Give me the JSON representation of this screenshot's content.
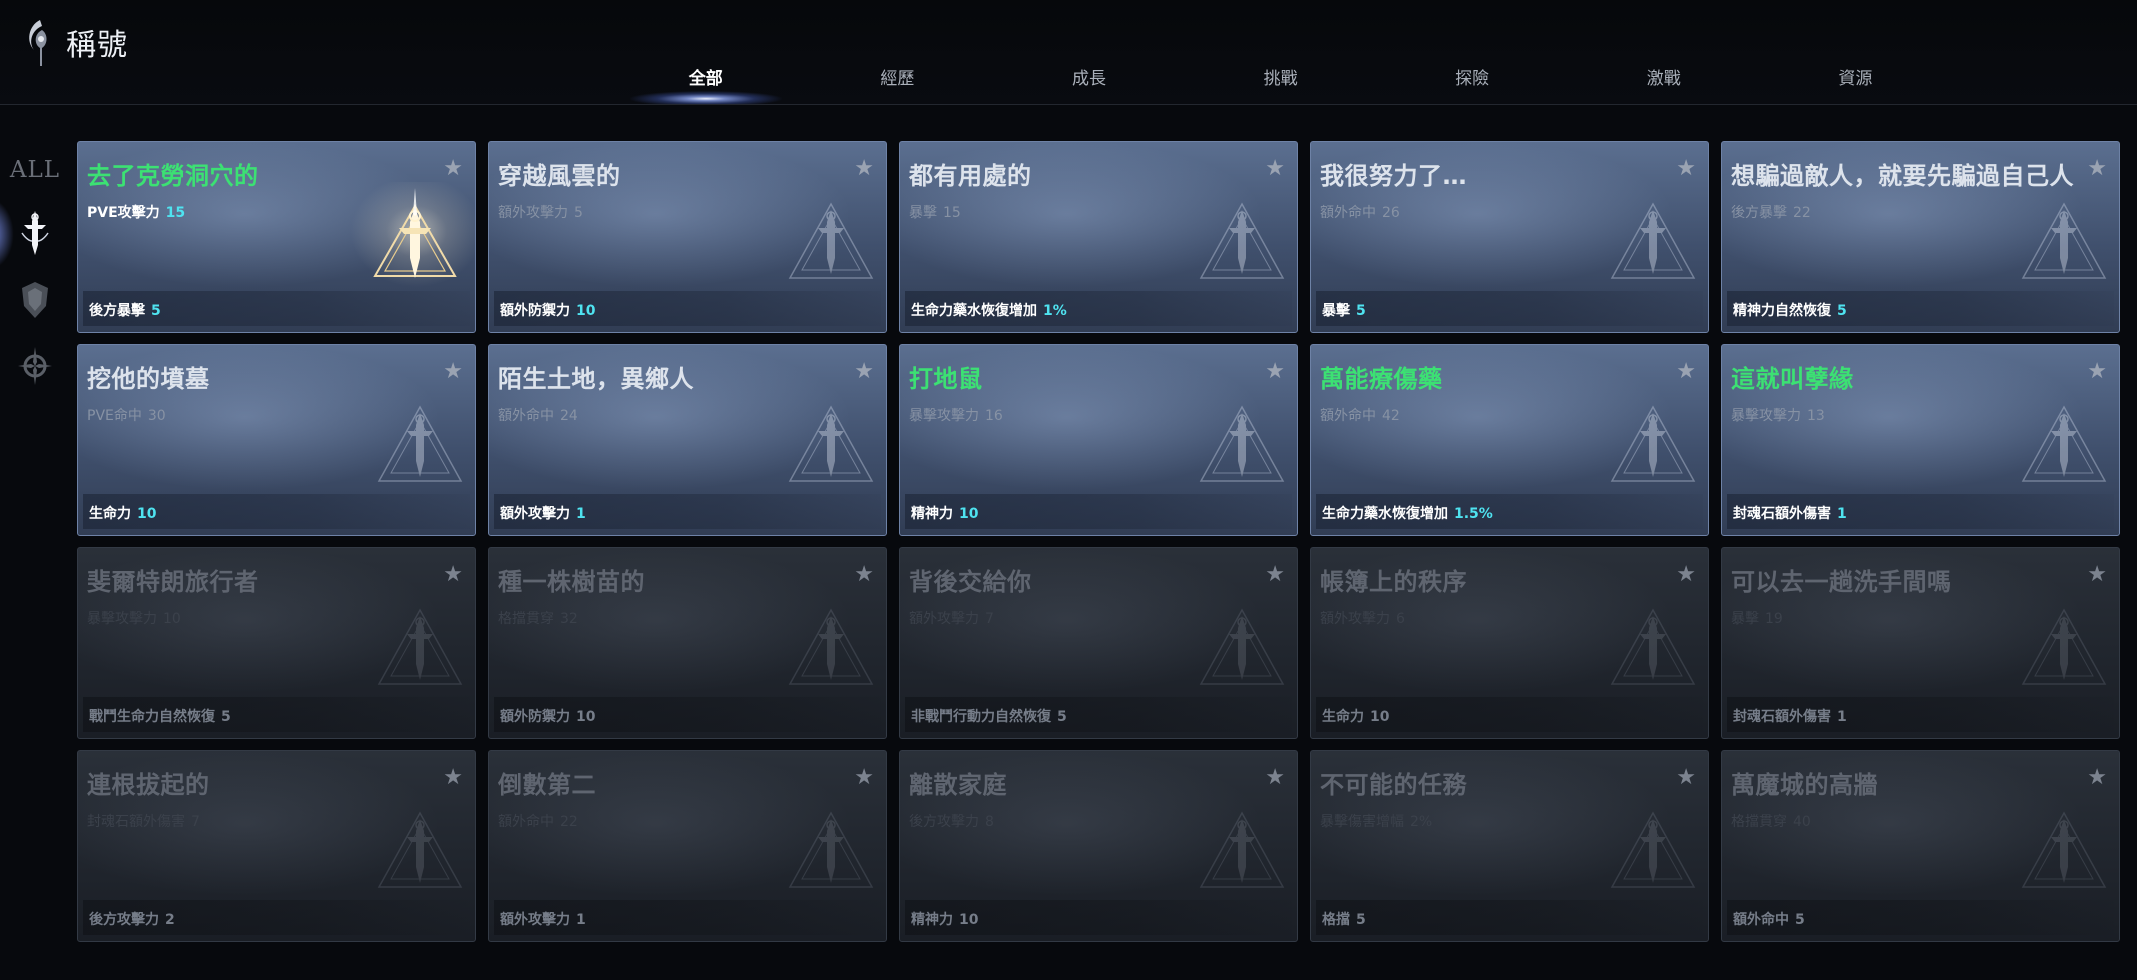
{
  "header": {
    "title": "稱號",
    "tabs": [
      "全部",
      "經歷",
      "成長",
      "挑戰",
      "探險",
      "激戰",
      "資源"
    ],
    "active_tab": "全部"
  },
  "rail": {
    "all_label": "ALL",
    "items": [
      "all-filter",
      "sword-emblem-icon",
      "shield-icon",
      "compass-icon"
    ],
    "selected": "sword-emblem-icon"
  },
  "colors": {
    "accent_cyan": "#4fe3f0",
    "title_green": "#3ce173",
    "card_blue": "#4a5b79"
  },
  "cards": [
    {
      "title": "去了克勞洞穴的",
      "green": true,
      "locked": false,
      "gold": true,
      "stat1": "PVE攻擊力",
      "stat1_value": "15",
      "stat1_bright": true,
      "stat2": "後方暴擊",
      "stat2_value": "5"
    },
    {
      "title": "穿越風雲的",
      "green": false,
      "locked": false,
      "gold": false,
      "stat1": "額外攻擊力",
      "stat1_value": "5",
      "stat1_bright": false,
      "stat2": "額外防禦力",
      "stat2_value": "10"
    },
    {
      "title": "都有用處的",
      "green": false,
      "locked": false,
      "gold": false,
      "stat1": "暴擊",
      "stat1_value": "15",
      "stat1_bright": false,
      "stat2": "生命力藥水恢復增加",
      "stat2_value": "1%"
    },
    {
      "title": "我很努力了…",
      "green": false,
      "locked": false,
      "gold": false,
      "stat1": "額外命中",
      "stat1_value": "26",
      "stat1_bright": false,
      "stat2": "暴擊",
      "stat2_value": "5"
    },
    {
      "title": "想騙過敵人，就要先騙過自己人",
      "green": false,
      "locked": false,
      "gold": false,
      "stat1": "後方暴擊",
      "stat1_value": "22",
      "stat1_bright": false,
      "stat2": "精神力自然恢復",
      "stat2_value": "5"
    },
    {
      "title": "挖他的墳墓",
      "green": false,
      "locked": false,
      "gold": false,
      "stat1": "PVE命中",
      "stat1_value": "30",
      "stat1_bright": false,
      "stat2": "生命力",
      "stat2_value": "10"
    },
    {
      "title": "陌生土地，異鄉人",
      "green": false,
      "locked": false,
      "gold": false,
      "stat1": "額外命中",
      "stat1_value": "24",
      "stat1_bright": false,
      "stat2": "額外攻擊力",
      "stat2_value": "1"
    },
    {
      "title": "打地鼠",
      "green": true,
      "locked": false,
      "gold": false,
      "stat1": "暴擊攻擊力",
      "stat1_value": "16",
      "stat1_bright": false,
      "stat2": "精神力",
      "stat2_value": "10"
    },
    {
      "title": "萬能療傷藥",
      "green": true,
      "locked": false,
      "gold": false,
      "stat1": "額外命中",
      "stat1_value": "42",
      "stat1_bright": false,
      "stat2": "生命力藥水恢復增加",
      "stat2_value": "1.5%"
    },
    {
      "title": "這就叫孽緣",
      "green": true,
      "locked": false,
      "gold": false,
      "stat1": "暴擊攻擊力",
      "stat1_value": "13",
      "stat1_bright": false,
      "stat2": "封魂石額外傷害",
      "stat2_value": "1"
    },
    {
      "title": "斐爾特朗旅行者",
      "green": false,
      "locked": true,
      "gold": false,
      "stat1": "暴擊攻擊力",
      "stat1_value": "10",
      "stat1_bright": false,
      "stat2": "戰鬥生命力自然恢復",
      "stat2_value": "5"
    },
    {
      "title": "種一株樹苗的",
      "green": false,
      "locked": true,
      "gold": false,
      "stat1": "格擋貫穿",
      "stat1_value": "32",
      "stat1_bright": false,
      "stat2": "額外防禦力",
      "stat2_value": "10"
    },
    {
      "title": "背後交給你",
      "green": false,
      "locked": true,
      "gold": false,
      "stat1": "額外攻擊力",
      "stat1_value": "7",
      "stat1_bright": false,
      "stat2": "非戰鬥行動力自然恢復",
      "stat2_value": "5"
    },
    {
      "title": "帳簿上的秩序",
      "green": false,
      "locked": true,
      "gold": false,
      "stat1": "額外攻擊力",
      "stat1_value": "6",
      "stat1_bright": false,
      "stat2": "生命力",
      "stat2_value": "10"
    },
    {
      "title": "可以去一趟洗手間嗎",
      "green": false,
      "locked": true,
      "gold": false,
      "stat1": "暴擊",
      "stat1_value": "19",
      "stat1_bright": false,
      "stat2": "封魂石額外傷害",
      "stat2_value": "1"
    },
    {
      "title": "連根拔起的",
      "green": false,
      "locked": true,
      "gold": false,
      "stat1": "封魂石額外傷害",
      "stat1_value": "7",
      "stat1_bright": false,
      "stat2": "後方攻擊力",
      "stat2_value": "2"
    },
    {
      "title": "倒數第二",
      "green": false,
      "locked": true,
      "gold": false,
      "stat1": "額外命中",
      "stat1_value": "22",
      "stat1_bright": false,
      "stat2": "額外攻擊力",
      "stat2_value": "1"
    },
    {
      "title": "離散家庭",
      "green": false,
      "locked": true,
      "gold": false,
      "stat1": "後方攻擊力",
      "stat1_value": "8",
      "stat1_bright": false,
      "stat2": "精神力",
      "stat2_value": "10"
    },
    {
      "title": "不可能的任務",
      "green": false,
      "locked": true,
      "gold": false,
      "stat1": "暴擊傷害增幅",
      "stat1_value": "2%",
      "stat1_bright": false,
      "stat2": "格擋",
      "stat2_value": "5"
    },
    {
      "title": "萬魔城的高牆",
      "green": false,
      "locked": true,
      "gold": false,
      "stat1": "格擋貫穿",
      "stat1_value": "40",
      "stat1_bright": false,
      "stat2": "額外命中",
      "stat2_value": "5"
    }
  ]
}
